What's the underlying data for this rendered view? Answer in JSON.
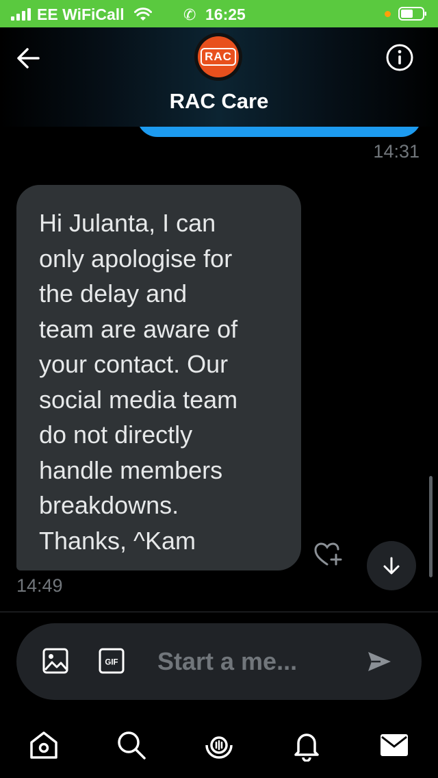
{
  "status_bar": {
    "carrier": "EE WiFiCall",
    "time": "16:25",
    "phone_glyph": "✆"
  },
  "header": {
    "logo_text": "RAC",
    "title": "RAC Care",
    "back_icon": "arrow-left-icon",
    "info_icon": "info-icon"
  },
  "conversation": {
    "previous_message_time": "14:31",
    "message": {
      "text": "Hi Julanta, I can\nonly apologise for\nthe delay and\nteam are aware of\nyour contact. Our\nsocial media team\ndo not directly\nhandle members\nbreakdowns.\nThanks, ^Kam",
      "time": "14:49"
    }
  },
  "composer": {
    "placeholder": "Start a me...",
    "gif_label": "GIF"
  },
  "tab_bar": {
    "items": [
      "home-icon",
      "search-icon",
      "spaces-icon",
      "notifications-icon",
      "messages-icon"
    ]
  },
  "colors": {
    "status_bar": "#5ac93f",
    "outgoing_bubble": "#1d9bf0",
    "incoming_bubble": "#2f3336",
    "logo": "#e8501d",
    "muted_text": "#71767b"
  }
}
